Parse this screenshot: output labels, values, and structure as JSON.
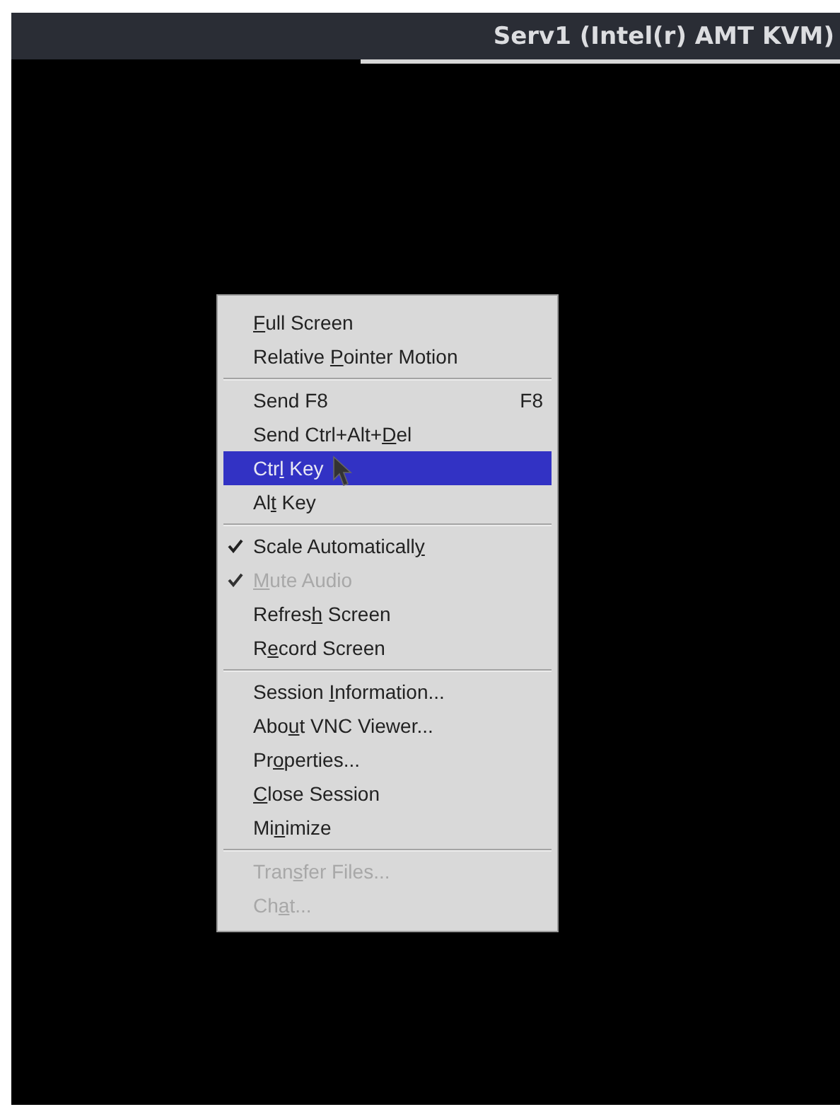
{
  "window": {
    "title": "Serv1 (Intel(r) AMT KVM)"
  },
  "menu": {
    "items": [
      {
        "kind": "item",
        "label": {
          "mnemonic": "F",
          "after": "ull Screen"
        },
        "checked": false,
        "disabled": false,
        "selected": false
      },
      {
        "kind": "item",
        "label": {
          "before": "Relative ",
          "mnemonic": "P",
          "after": "ointer Motion"
        },
        "checked": false,
        "disabled": false,
        "selected": false
      },
      {
        "kind": "separator"
      },
      {
        "kind": "item",
        "label": {
          "before": "Send F8"
        },
        "shortcut": "F8",
        "checked": false,
        "disabled": false,
        "selected": false
      },
      {
        "kind": "item",
        "label": {
          "before": "Send Ctrl+Alt+",
          "mnemonic": "D",
          "after": "el"
        },
        "checked": false,
        "disabled": false,
        "selected": false
      },
      {
        "kind": "item",
        "label": {
          "before": "Ctr",
          "mnemonic": "l",
          "after": " Key"
        },
        "checked": false,
        "disabled": false,
        "selected": true
      },
      {
        "kind": "item",
        "label": {
          "before": "Al",
          "mnemonic": "t",
          "after": " Key"
        },
        "checked": false,
        "disabled": false,
        "selected": false
      },
      {
        "kind": "separator"
      },
      {
        "kind": "item",
        "label": {
          "before": "Scale Automaticall",
          "mnemonic": "y"
        },
        "checked": true,
        "disabled": false,
        "selected": false
      },
      {
        "kind": "item",
        "label": {
          "mnemonic": "M",
          "after": "ute Audio"
        },
        "checked": true,
        "disabled": true,
        "selected": false
      },
      {
        "kind": "item",
        "label": {
          "before": "Refres",
          "mnemonic": "h",
          "after": " Screen"
        },
        "checked": false,
        "disabled": false,
        "selected": false
      },
      {
        "kind": "item",
        "label": {
          "before": "R",
          "mnemonic": "e",
          "after": "cord Screen"
        },
        "checked": false,
        "disabled": false,
        "selected": false
      },
      {
        "kind": "separator"
      },
      {
        "kind": "item",
        "label": {
          "before": "Session ",
          "mnemonic": "I",
          "after": "nformation..."
        },
        "checked": false,
        "disabled": false,
        "selected": false
      },
      {
        "kind": "item",
        "label": {
          "before": "Abo",
          "mnemonic": "u",
          "after": "t VNC Viewer..."
        },
        "checked": false,
        "disabled": false,
        "selected": false
      },
      {
        "kind": "item",
        "label": {
          "before": "Pr",
          "mnemonic": "o",
          "after": "perties..."
        },
        "checked": false,
        "disabled": false,
        "selected": false
      },
      {
        "kind": "item",
        "label": {
          "mnemonic": "C",
          "after": "lose Session"
        },
        "checked": false,
        "disabled": false,
        "selected": false
      },
      {
        "kind": "item",
        "label": {
          "before": "Mi",
          "mnemonic": "n",
          "after": "imize"
        },
        "checked": false,
        "disabled": false,
        "selected": false
      },
      {
        "kind": "separator"
      },
      {
        "kind": "item",
        "label": {
          "before": "Tran",
          "mnemonic": "s",
          "after": "fer Files..."
        },
        "checked": false,
        "disabled": true,
        "selected": false
      },
      {
        "kind": "item",
        "label": {
          "before": "Ch",
          "mnemonic": "a",
          "after": "t..."
        },
        "checked": false,
        "disabled": true,
        "selected": false
      }
    ]
  }
}
